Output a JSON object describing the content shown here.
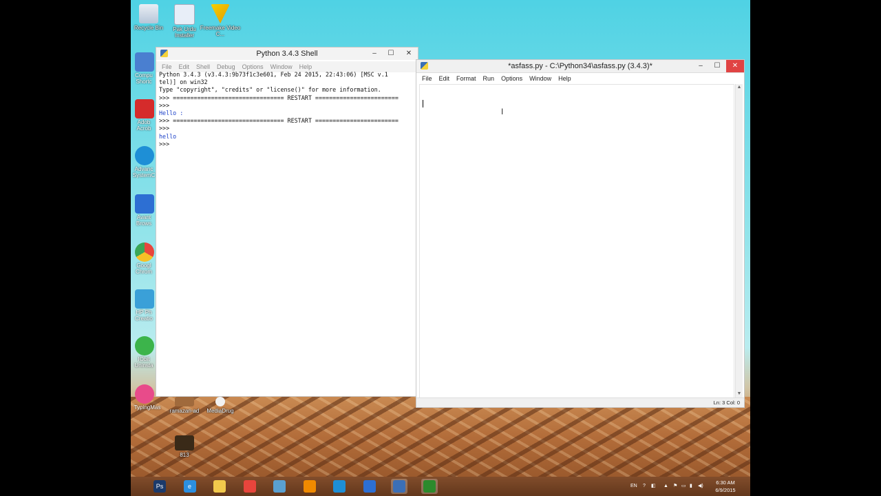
{
  "desktop": {
    "icons_top": [
      {
        "label": "Recycle Bin",
        "color": "#c9d6e6"
      },
      {
        "label": "Pak Urdu Installer",
        "color": "#e8eef8"
      },
      {
        "label": "Freemake Video C...",
        "color": "#f2c200"
      }
    ],
    "icons_side": [
      {
        "label": "Compu Shortc",
        "color": "#4a7fd0"
      },
      {
        "label": "Adob Acrob",
        "color": "#d52b2b"
      },
      {
        "label": "Advanc SystemC",
        "color": "#1e8fd6"
      },
      {
        "label": "Avant Brows",
        "color": "#2d6fd3"
      },
      {
        "label": "Googl Chrom",
        "color": "#e8453c"
      },
      {
        "label": "HP Ph Creatio",
        "color": "#3aa0d8"
      },
      {
        "label": "IObit Uninsta",
        "color": "#3cb44b"
      },
      {
        "label": "TypingMas",
        "color": "#e84b8a"
      }
    ],
    "icons_bottom": [
      {
        "label": "ramazan-ad",
        "color": "#a06a3c"
      },
      {
        "label": "MediaDrug",
        "color": "#f2f2f2"
      },
      {
        "label": "813",
        "color": "#3a2a18"
      }
    ]
  },
  "shell": {
    "title": "Python 3.4.3 Shell",
    "menu": [
      "File",
      "Edit",
      "Shell",
      "Debug",
      "Options",
      "Window",
      "Help"
    ],
    "lines": [
      {
        "text": "Python 3.4.3 (v3.4.3:9b73f1c3e601, Feb 24 2015, 22:43:06) [MSC v.1",
        "cls": ""
      },
      {
        "text": "tel)] on win32",
        "cls": ""
      },
      {
        "text": "Type \"copyright\", \"credits\" or \"license()\" for more information.",
        "cls": ""
      },
      {
        "text": ">>> ================================ RESTART ========================",
        "cls": ""
      },
      {
        "text": ">>> ",
        "cls": ""
      },
      {
        "text": "Hello :",
        "cls": "out-blue"
      },
      {
        "text": ">>> ================================ RESTART ========================",
        "cls": ""
      },
      {
        "text": ">>> ",
        "cls": ""
      },
      {
        "text": "hello",
        "cls": "out-blue"
      },
      {
        "text": ">>> ",
        "cls": ""
      }
    ]
  },
  "editor": {
    "title": "*asfass.py - C:\\Python34\\asfass.py (3.4.3)*",
    "menu": [
      "File",
      "Edit",
      "Format",
      "Run",
      "Options",
      "Window",
      "Help"
    ],
    "status": "Ln: 3  Col: 0"
  },
  "window_controls": {
    "minimize": "–",
    "maximize": "☐",
    "close": "✕"
  },
  "taskbar": {
    "apps": [
      {
        "name": "photoshop",
        "color": "#1b3a6b",
        "label": "Ps"
      },
      {
        "name": "internet-explorer",
        "color": "#2b8fe0",
        "label": "e"
      },
      {
        "name": "file-explorer",
        "color": "#f2c94c",
        "label": ""
      },
      {
        "name": "chrome",
        "color": "#e8453c",
        "label": ""
      },
      {
        "name": "store",
        "color": "#5aa0d0",
        "label": ""
      },
      {
        "name": "vlc",
        "color": "#f08a00",
        "label": ""
      },
      {
        "name": "advanced-systemcare",
        "color": "#1e8fd6",
        "label": ""
      },
      {
        "name": "avant",
        "color": "#2d6fd3",
        "label": ""
      },
      {
        "name": "python",
        "color": "#3b6fb6",
        "label": ""
      },
      {
        "name": "camtasia",
        "color": "#2c8a2c",
        "label": ""
      }
    ],
    "language": "EN",
    "time": "6:30 AM",
    "date": "6/9/2015"
  }
}
